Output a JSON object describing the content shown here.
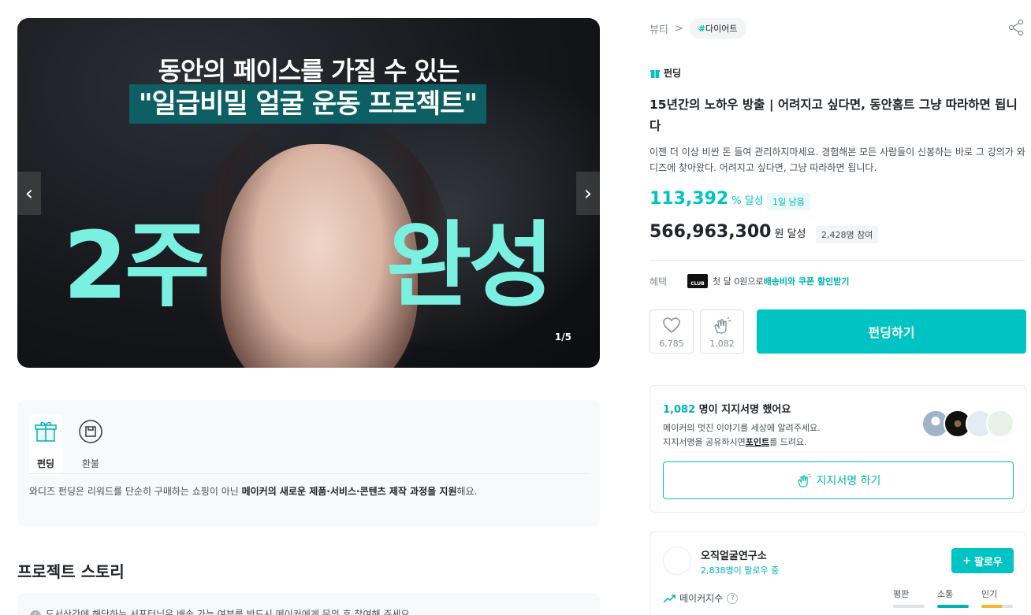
{
  "hero": {
    "headline1": "동안의 페이스를 가질 수 있는",
    "headline2": "\"일급비밀 얼굴 운동 프로젝트\"",
    "big_left": "2주",
    "big_right": "완성",
    "pager": "1/5",
    "prev_icon": "chevron-left-icon",
    "next_icon": "chevron-right-icon"
  },
  "info": {
    "tab_funding": "펀딩",
    "tab_refund": "환불",
    "desc_prefix": "와디즈 펀딩은 리워드를 단순히 구매하는 쇼핑이 아닌 ",
    "desc_bold": "메이커의 새로운 제품·서비스·콘텐츠 제작 과정을 지원",
    "desc_suffix": "해요."
  },
  "story": {
    "title": "프로젝트 스토리",
    "notice": "도서산간에 해당하는 서포터님은 배송 가능 여부를 반드시 메이커에게 문의 후 참여해 주세요."
  },
  "breadcrumb": {
    "category": "뷰티",
    "separator": ">",
    "tag": "다이어트",
    "tag_hash": "#"
  },
  "project": {
    "type_label": "펀딩",
    "title": "15년간의 노하우 방출 | 어려지고 싶다면, 동안홈트 그냥 따라하면 됩니다",
    "summary": "이젠 더 이상 비싼 돈 들여 관리하지마세요. 경험해본 모든 사람들이 신봉하는 바로 그 강의가 와디즈에 찾아왔다. 어려지고 싶다면, 그냥 따라하면 됩니다.",
    "achievement": "113,392",
    "achievement_unit": "% 달성",
    "days_left": "1일 남음",
    "amount": "566,963,300",
    "amount_unit": "원 달성",
    "participants": "2,428명 참여"
  },
  "benefit": {
    "label": "혜택",
    "club_badge": "CLUB",
    "text_prefix": "첫 달 0원으로 ",
    "text_highlight": "배송비와 쿠폰 할인받기"
  },
  "actions": {
    "like_count": "6,785",
    "cheer_count": "1,082",
    "fund_button": "펀딩하기"
  },
  "signature": {
    "count": "1,082",
    "headline_suffix": " 명이 지지서명 했어요",
    "line1": "메이커의 멋진 이야기를 세상에 알려주세요.",
    "line2_prefix": "지지서명을 공유하시면",
    "line2_bold": "포인트",
    "line2_suffix": "를 드려요.",
    "button": "지지서명 하기"
  },
  "maker": {
    "name": "오직얼굴연구소",
    "followers": "2,838명이 팔로우 중",
    "follow_button": "팔로우",
    "index_label": "메이커지수",
    "metrics": [
      {
        "label": "평판",
        "level": 0.0,
        "color": "#dee2e6"
      },
      {
        "label": "소통",
        "level": 1.0,
        "color": "#00b2b2"
      },
      {
        "label": "인기",
        "level": 0.65,
        "color": "#f5b731"
      }
    ]
  },
  "colors": {
    "accent": "#00c4c4",
    "accent_text": "#00b2b2"
  }
}
